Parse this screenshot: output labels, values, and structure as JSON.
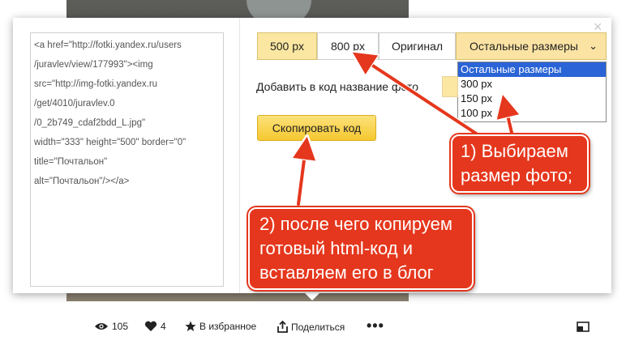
{
  "code": {
    "lines": [
      "<a href=\"http://fotki.yandex.ru/users",
      "/juravlev/view/177993\"><img",
      "src=\"http://img-fotki.yandex.ru",
      "/get/4010/juravlev.0",
      "/0_2b749_cdaf2bdd_L.jpg\"",
      "width=\"333\" height=\"500\" border=\"0\"",
      "title=\"Почтальон\"",
      "alt=\"Почтальон\"/></a>"
    ]
  },
  "sizes": {
    "b500": "500 px",
    "b800": "800 px",
    "original": "Оригинал",
    "other": "Остальные размеры",
    "chevron": "⌄"
  },
  "dropdown": {
    "options": [
      "Остальные размеры",
      "300 px",
      "150 px",
      "100 px"
    ],
    "selected_index": 0
  },
  "title_label": "Добавить в код название фото",
  "copy_button": "Скопировать код",
  "close_glyph": "×",
  "callouts": {
    "one": [
      "1) Выбираем",
      "размер фото;"
    ],
    "two": [
      "2) после чего копируем",
      "готовый html-код и",
      "вставляем его в блог"
    ]
  },
  "toolbar": {
    "views": "105",
    "likes": "4",
    "favorite": "В избранное",
    "share": "Поделиться",
    "more": "•••"
  },
  "icons": {
    "views": "eye-icon",
    "likes": "heart-icon",
    "favorite": "star-icon",
    "share": "share-icon",
    "expand": "expand-icon"
  },
  "colors": {
    "callout": "#e5371d",
    "selected_size": "#fbe7a2",
    "dropdown_highlight": "#2a64d6",
    "copy_button": "#f5c830"
  }
}
